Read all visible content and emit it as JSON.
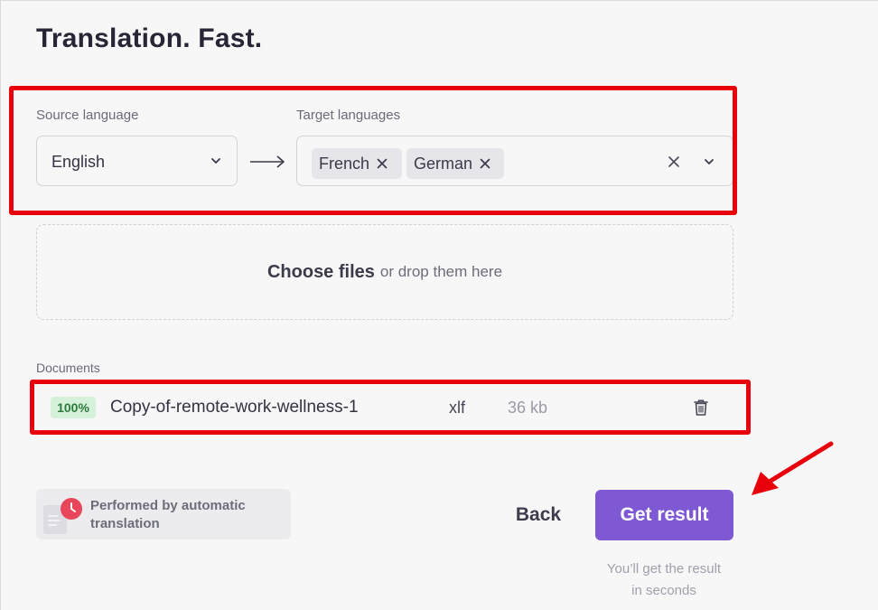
{
  "page": {
    "title": "Translation. Fast."
  },
  "languages": {
    "source_label": "Source language",
    "source_value": "English",
    "target_label": "Target languages",
    "targets": [
      "French",
      "German"
    ]
  },
  "dropzone": {
    "choose_label": "Choose files",
    "rest_label": "or drop them here"
  },
  "documents": {
    "label": "Documents",
    "items": [
      {
        "progress": "100%",
        "name": "Copy-of-remote-work-wellness-1",
        "ext": "xlf",
        "size": "36 kb"
      }
    ]
  },
  "footer": {
    "auto_line1": "Performed by automatic",
    "auto_line2": "translation",
    "back_label": "Back",
    "get_result_label": "Get result",
    "hint_line1": "You’ll get the result",
    "hint_line2": "in seconds"
  },
  "colors": {
    "accent": "#7f58d4",
    "highlight": "#e8000b",
    "badge_bg": "#d6f1d9",
    "badge_text": "#2c7a3c"
  },
  "icons": [
    "chevron-down-icon",
    "arrow-right-icon",
    "close-icon",
    "trash-icon",
    "document-clock-icon",
    "red-pointer-arrow"
  ]
}
